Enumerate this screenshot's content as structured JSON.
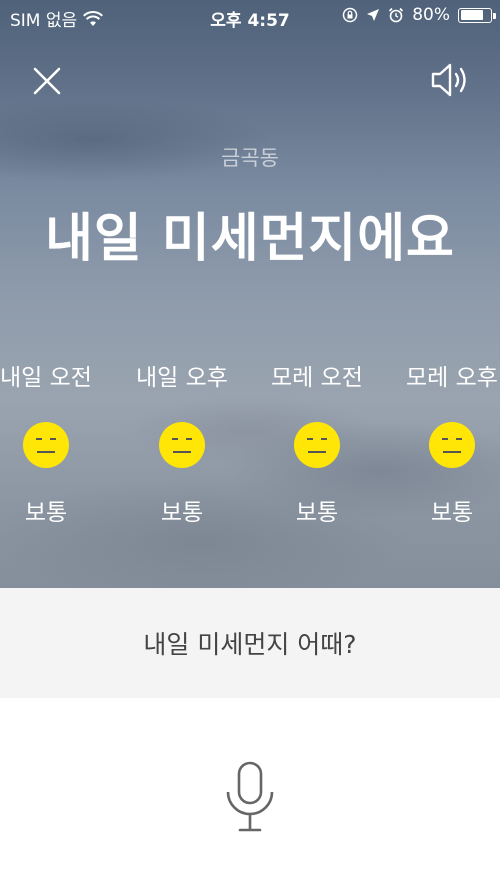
{
  "status_bar": {
    "carrier": "SIM 없음",
    "time": "오후 4:57",
    "battery_percent": "80%",
    "battery_level": 0.8
  },
  "header": {
    "close_icon": "close-icon",
    "speaker_icon": "speaker-icon"
  },
  "location": "금곡동",
  "headline": "내일 미세먼지에요",
  "forecast": [
    {
      "label": "내일 오전",
      "status": "보통",
      "icon": "neutral-face-icon"
    },
    {
      "label": "내일 오후",
      "status": "보통",
      "icon": "neutral-face-icon"
    },
    {
      "label": "모레 오전",
      "status": "보통",
      "icon": "neutral-face-icon"
    },
    {
      "label": "모레 오후",
      "status": "보통",
      "icon": "neutral-face-icon"
    }
  ],
  "query": "내일 미세먼지 어때?",
  "mic_icon": "microphone-icon",
  "colors": {
    "face": "#ffe606",
    "query_background": "#f4f4f5"
  }
}
